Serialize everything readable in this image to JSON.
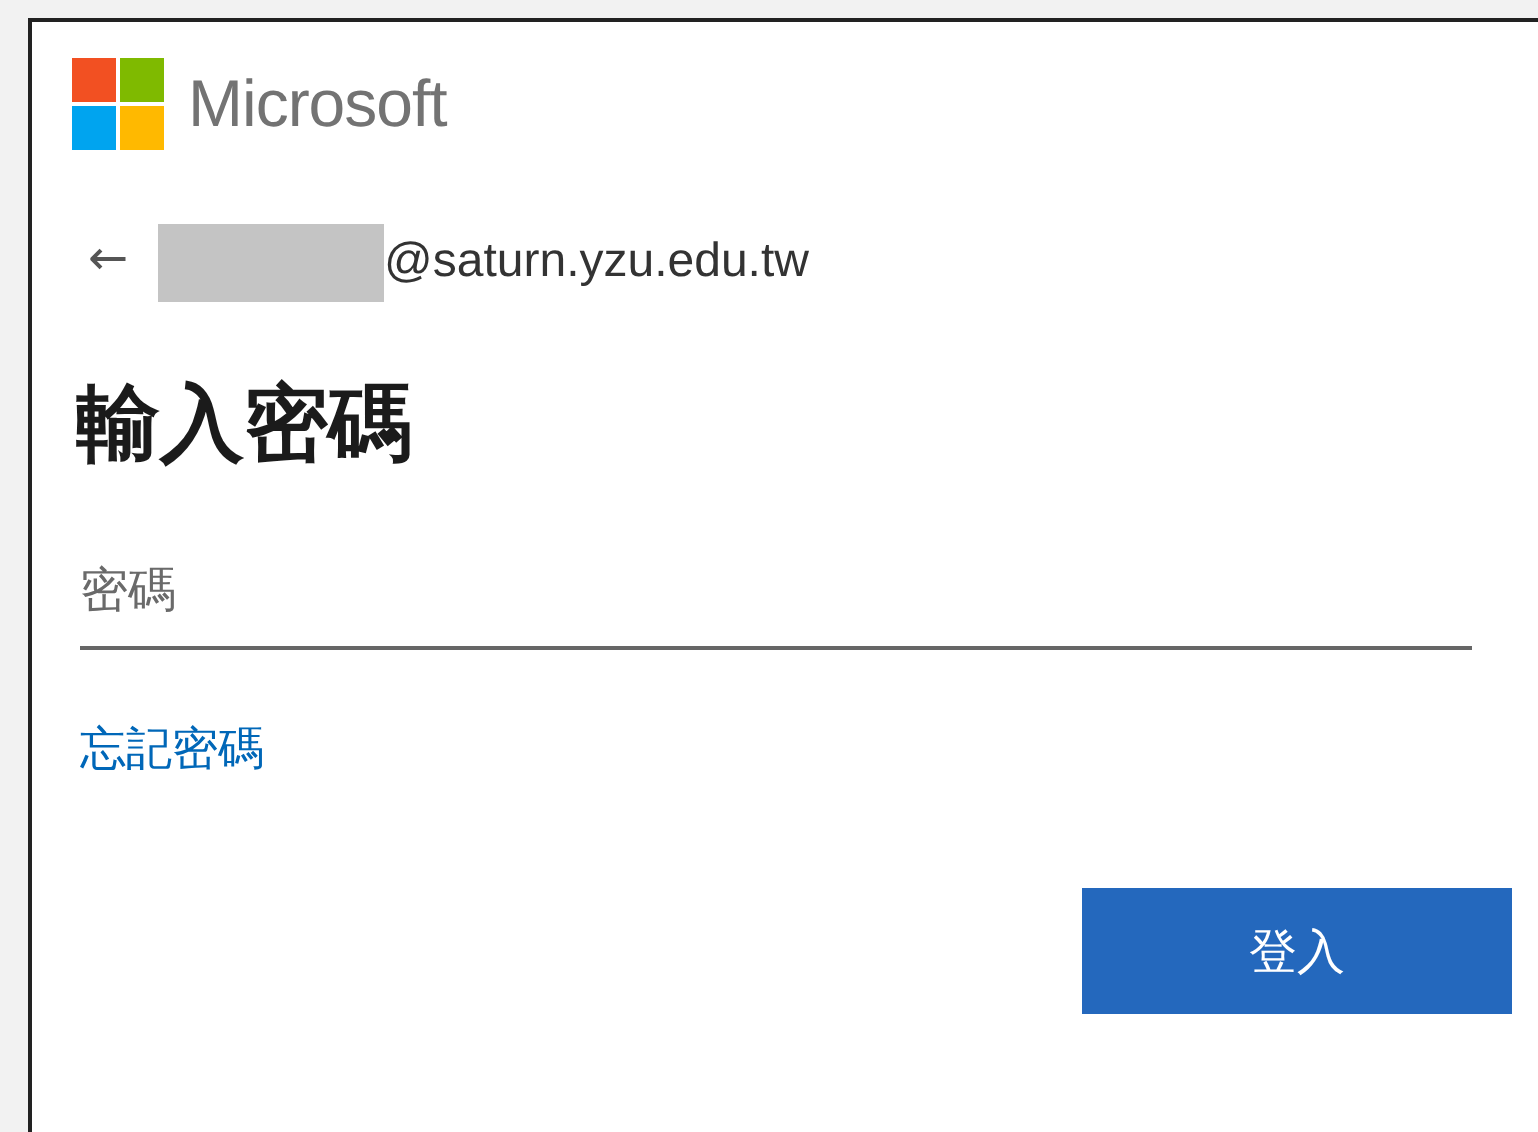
{
  "brand": {
    "name": "Microsoft"
  },
  "account": {
    "back": "←",
    "email": "@saturn.yzu.edu.tw"
  },
  "title": "輸入密碼",
  "password_field": {
    "placeholder": "密碼"
  },
  "forgot_link": "忘記密碼",
  "buttons": [
    "登入"
  ]
}
